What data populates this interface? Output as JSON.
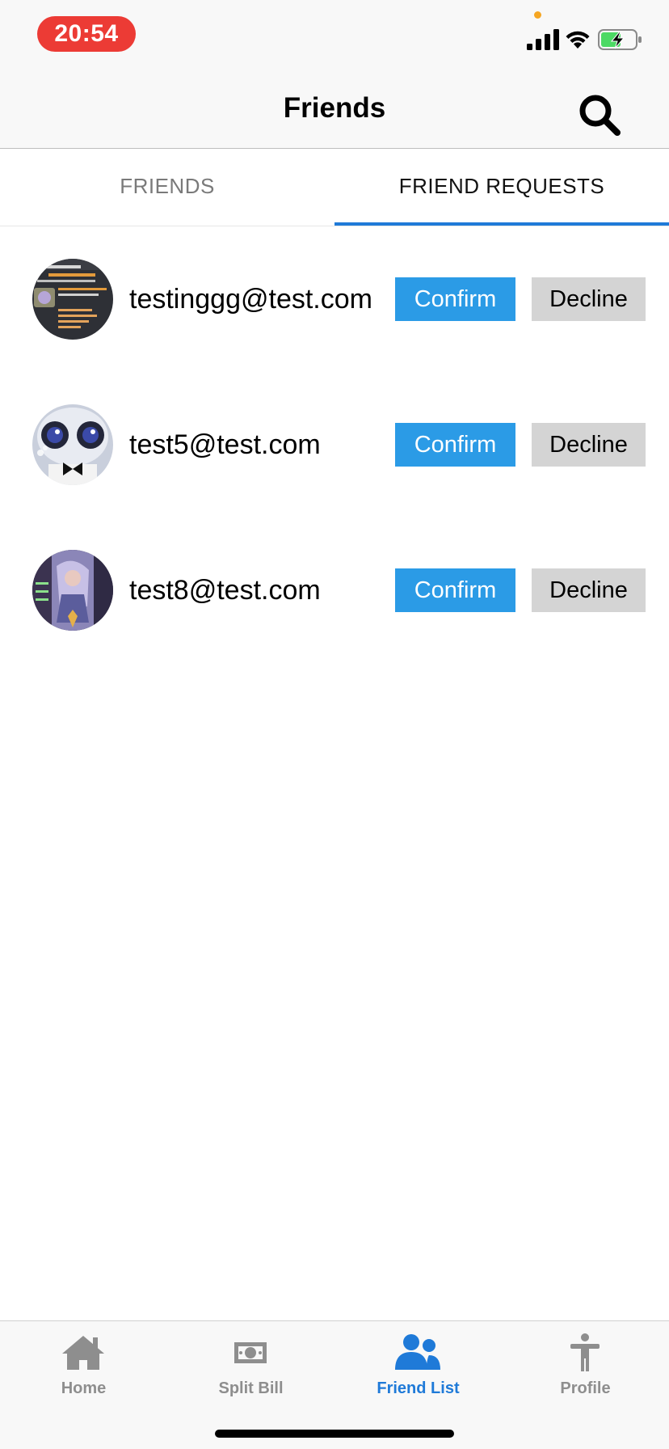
{
  "status_bar": {
    "time": "20:54",
    "colors": {
      "time_pill": "#ec3b35",
      "battery_fill": "#4cd964",
      "dot": "#f5a623"
    }
  },
  "header": {
    "title": "Friends",
    "search_icon": "search-icon"
  },
  "tabs": [
    {
      "label": "FRIENDS",
      "active": false
    },
    {
      "label": "FRIEND REQUESTS",
      "active": true
    }
  ],
  "requests": [
    {
      "email": "testinggg@test.com",
      "confirm_label": "Confirm",
      "decline_label": "Decline",
      "avatar": "screenshot-thumbnail-avatar"
    },
    {
      "email": "test5@test.com",
      "confirm_label": "Confirm",
      "decline_label": "Decline",
      "avatar": "robot-avatar"
    },
    {
      "email": "test8@test.com",
      "confirm_label": "Confirm",
      "decline_label": "Decline",
      "avatar": "game-art-avatar"
    }
  ],
  "bottom_nav": [
    {
      "label": "Home",
      "icon": "home-icon",
      "active": false
    },
    {
      "label": "Split Bill",
      "icon": "money-icon",
      "active": false
    },
    {
      "label": "Friend List",
      "icon": "people-icon",
      "active": true
    },
    {
      "label": "Profile",
      "icon": "person-icon",
      "active": false
    }
  ],
  "colors": {
    "accent": "#1f7ad8",
    "confirm_button": "#2b9be6",
    "decline_button": "#d4d4d4",
    "inactive_text": "#8e8e8e"
  }
}
